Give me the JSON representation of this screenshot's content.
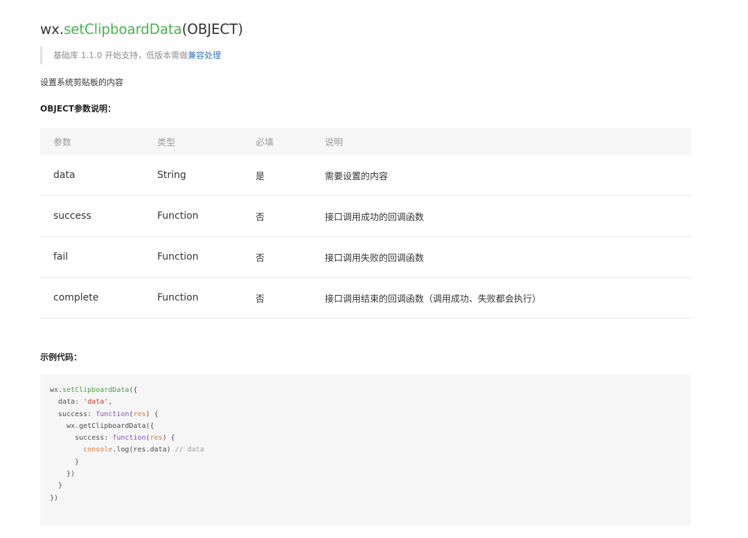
{
  "title": {
    "prefix": "wx.",
    "fn": "setClipboardData",
    "suffix": "(OBJECT)"
  },
  "note": {
    "text": "基础库 1.1.0 开始支持，低版本需做",
    "link": "兼容处理"
  },
  "description": "设置系统剪贴板的内容",
  "params_heading": "OBJECT参数说明：",
  "params_table": {
    "headers": [
      "参数",
      "类型",
      "必填",
      "说明"
    ],
    "rows": [
      [
        "data",
        "String",
        "是",
        "需要设置的内容"
      ],
      [
        "success",
        "Function",
        "否",
        "接口调用成功的回调函数"
      ],
      [
        "fail",
        "Function",
        "否",
        "接口调用失败的回调函数"
      ],
      [
        "complete",
        "Function",
        "否",
        "接口调用结束的回调函数（调用成功、失败都会执行）"
      ]
    ]
  },
  "example_heading": "示例代码：",
  "code": {
    "l1_obj": "wx.",
    "l1_fn": "setClipboardData",
    "l1_rest": "({",
    "l2_key": "  data: ",
    "l2_str": "'data'",
    "l2_rest": ",",
    "l3_key": "  success: ",
    "l3_kw": "function",
    "l3_p1": "(",
    "l3_param": "res",
    "l3_rest": ") {",
    "l4": "    wx.getClipboardData({",
    "l5_key": "      success: ",
    "l5_kw": "function",
    "l5_p1": "(",
    "l5_param": "res",
    "l5_rest": ") {",
    "l6_ind": "        ",
    "l6_obj": "console",
    "l6_mid": ".log(res.data) ",
    "l6_cm": "// data",
    "l7": "      }",
    "l8": "    })",
    "l9": "  }",
    "l10": "})"
  }
}
